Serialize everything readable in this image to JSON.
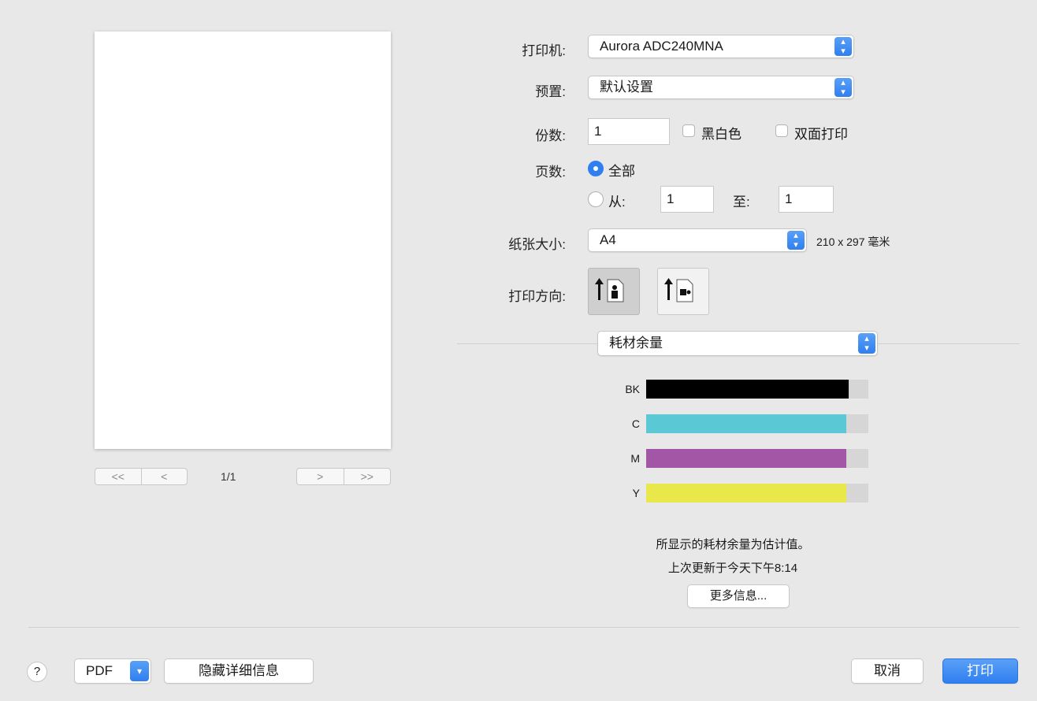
{
  "preview": {
    "page_indicator": "1/1",
    "nav_first": "<<",
    "nav_prev": "<",
    "nav_next": ">",
    "nav_last": ">>"
  },
  "printer": {
    "label": "打印机:",
    "value": "Aurora ADC240MNA"
  },
  "preset": {
    "label": "预置:",
    "value": "默认设置"
  },
  "copies": {
    "label": "份数:",
    "value": "1",
    "bw_label": "黑白色",
    "duplex_label": "双面打印",
    "bw_checked": false,
    "duplex_checked": false
  },
  "pages": {
    "label": "页数:",
    "all_label": "全部",
    "from_label": "从:",
    "from_value": "1",
    "to_label": "至:",
    "to_value": "1",
    "selected": "all"
  },
  "paper": {
    "label": "纸张大小:",
    "value": "A4",
    "dimensions": "210 x 297 毫米"
  },
  "orientation": {
    "label": "打印方向:",
    "selected": "portrait"
  },
  "section": {
    "value": "耗材余量"
  },
  "supplies": [
    {
      "name": "BK",
      "level": 0.91,
      "color": "#000000"
    },
    {
      "name": "C",
      "level": 0.9,
      "color": "#5bc8d6"
    },
    {
      "name": "M",
      "level": 0.9,
      "color": "#a456a6"
    },
    {
      "name": "Y",
      "level": 0.9,
      "color": "#e8e84a"
    }
  ],
  "info": {
    "estimate_note": "所显示的耗材余量为估计值。",
    "last_update": "上次更新于今天下午8:14",
    "more_info_button": "更多信息..."
  },
  "footer": {
    "help": "?",
    "pdf_label": "PDF",
    "hide_details": "隐藏详细信息",
    "cancel": "取消",
    "print": "打印"
  },
  "colors": {
    "accent": "#2f7ff0",
    "background": "#e8e8e8"
  }
}
